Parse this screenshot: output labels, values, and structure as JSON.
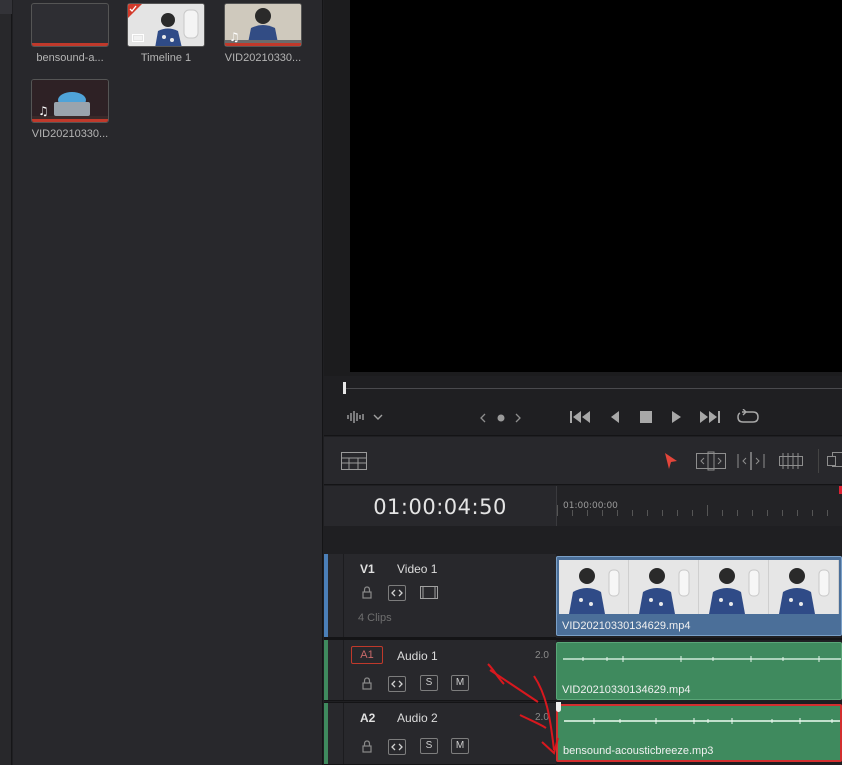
{
  "media_pool": {
    "clips": [
      {
        "name": "bensound-a...",
        "kind": "audio"
      },
      {
        "name": "Timeline 1",
        "kind": "timeline"
      },
      {
        "name": "VID20210330...",
        "kind": "video"
      },
      {
        "name": "VID20210330...",
        "kind": "video"
      }
    ]
  },
  "transport": {
    "audio_meter_icon": "waveform-icon",
    "icons": [
      "jump-to-start-icon",
      "step-back-icon",
      "stop-icon",
      "play-icon",
      "jump-to-end-icon",
      "loop-icon"
    ]
  },
  "timeline": {
    "timecode": "01:00:04:50",
    "ruler_start": "01:00:00:00",
    "tracks": {
      "v1": {
        "id": "V1",
        "name": "Video 1",
        "clip_count": "4 Clips",
        "clip_name": "VID20210330134629.mp4"
      },
      "a1": {
        "id": "A1",
        "name": "Audio 1",
        "channels": "2.0",
        "clip_name": "VID20210330134629.mp4"
      },
      "a2": {
        "id": "A2",
        "name": "Audio 2",
        "channels": "2.0",
        "clip_name": "bensound-acousticbreeze.mp3"
      }
    },
    "solo_label": "S",
    "mute_label": "M"
  },
  "colors": {
    "video_track": "#4b6f99",
    "audio_track": "#3f8a5e",
    "selection": "#d32f2f",
    "annotation": "#d8181e"
  }
}
